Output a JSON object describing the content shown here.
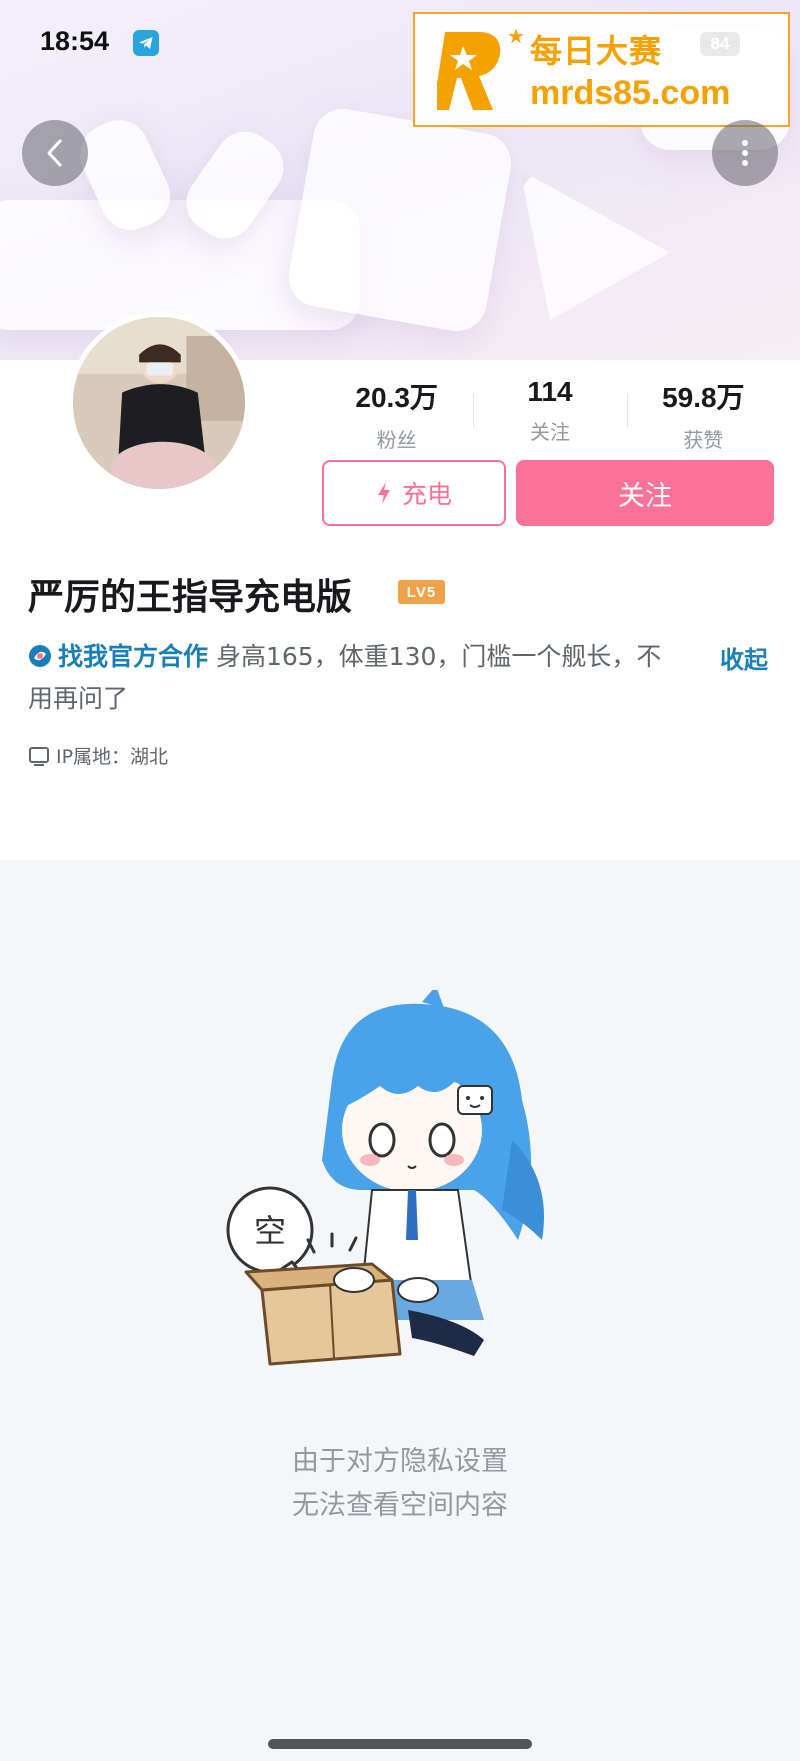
{
  "status_bar": {
    "time": "18:54",
    "battery": "84"
  },
  "watermark": {
    "line1": "每日大赛",
    "line2": "mrds85.com"
  },
  "profile": {
    "stats": [
      {
        "value": "20.3万",
        "label": "粉丝"
      },
      {
        "value": "114",
        "label": "关注"
      },
      {
        "value": "59.8万",
        "label": "获赞"
      }
    ],
    "charge_label": "充电",
    "follow_label": "关注",
    "username": "严厉的王指导充电版",
    "level_badge": "LV5",
    "bio_link": "找我官方合作",
    "bio_text": "身高165，体重130，门槛一个舰长，不用再问了",
    "collapse_label": "收起",
    "ip_location": "IP属地：湖北"
  },
  "empty_state": {
    "bubble_char": "空",
    "line1": "由于对方隐私设置",
    "line2": "无法查看空间内容"
  },
  "colors": {
    "accent_pink": "#fb7299",
    "link_blue": "#1a7fb8",
    "watermark_orange": "#f5a100"
  }
}
